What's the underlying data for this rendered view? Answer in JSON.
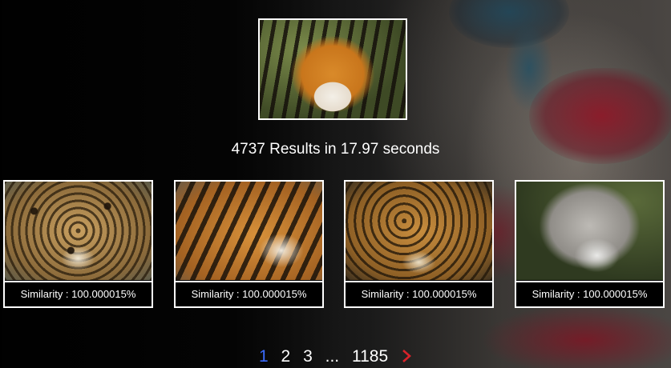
{
  "query": {
    "image": "tiger-face-photo"
  },
  "stats": {
    "text": "4737 Results in 17.97 seconds"
  },
  "results": [
    {
      "image": "jaguar-photo",
      "similarity": "Similarity : 100.000015%"
    },
    {
      "image": "tiger-photo",
      "similarity": "Similarity : 100.000015%"
    },
    {
      "image": "leopard-photo",
      "similarity": "Similarity : 100.000015%"
    },
    {
      "image": "wolf-photo",
      "similarity": "Similarity : 100.000015%"
    }
  ],
  "pagination": {
    "pages": [
      "1",
      "2",
      "3"
    ],
    "ellipsis": "...",
    "last": "1185",
    "next_icon": "chevron-right-icon",
    "active_color": "#3b6cff",
    "next_color": "#d8232a"
  }
}
